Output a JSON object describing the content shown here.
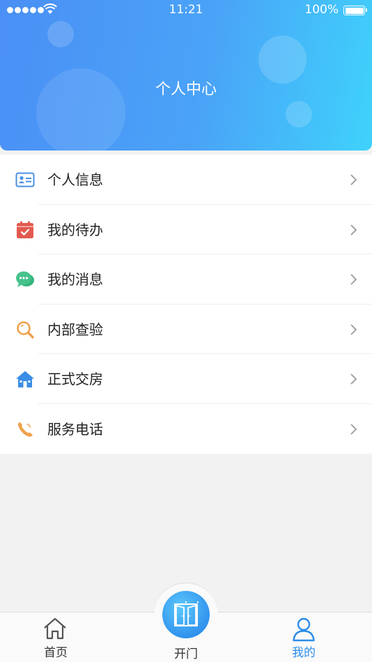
{
  "status_bar": {
    "time": "11:21",
    "battery": "100%"
  },
  "header": {
    "title": "个人中心"
  },
  "menu": [
    {
      "label": "个人信息",
      "icon": "id-card-icon"
    },
    {
      "label": "我的待办",
      "icon": "calendar-check-icon"
    },
    {
      "label": "我的消息",
      "icon": "chat-bubble-icon"
    },
    {
      "label": "内部查验",
      "icon": "magnifier-icon"
    },
    {
      "label": "正式交房",
      "icon": "house-icon"
    },
    {
      "label": "服务电话",
      "icon": "phone-icon"
    }
  ],
  "tabbar": {
    "home": "首页",
    "open_door": "开门",
    "mine": "我的",
    "active": "我的"
  },
  "colors": {
    "header_gradient_start": "#4a8ff5",
    "header_gradient_end": "#3fd2fb",
    "active_tab": "#2c8ce8"
  }
}
